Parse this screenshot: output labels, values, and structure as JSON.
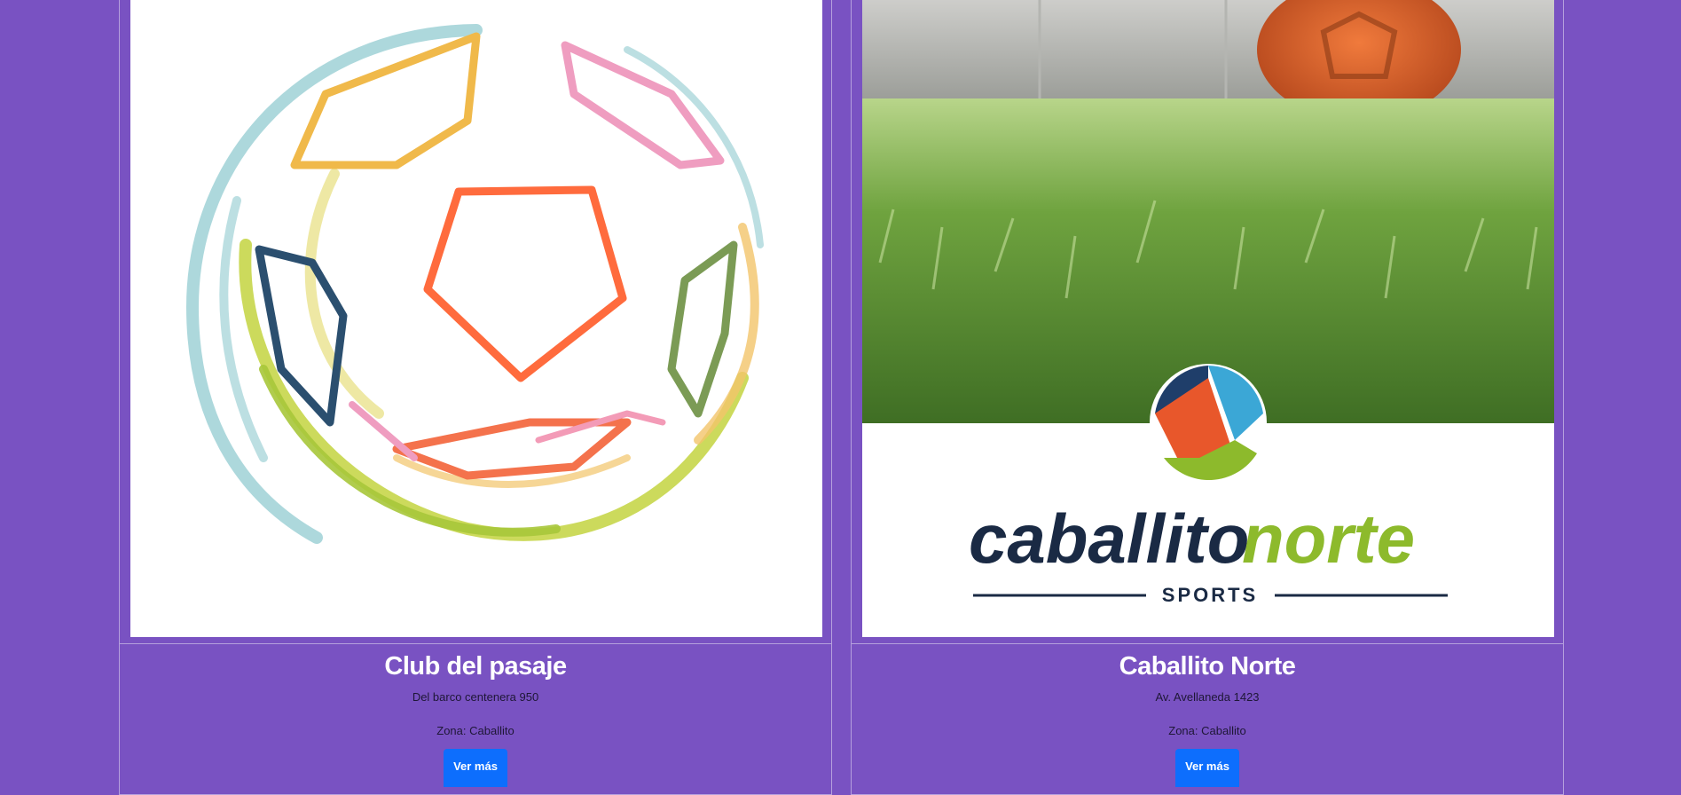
{
  "clubs": [
    {
      "name": "Club del pasaje",
      "address": "Del barco centenera 950",
      "zone": "Zona: Caballito",
      "button_label": "Ver más",
      "image": "soccer-ball-logo"
    },
    {
      "name": "Caballito Norte",
      "address": "Av. Avellaneda 1423",
      "zone": "Zona: Caballito",
      "button_label": "Ver más",
      "image": "caballito-norte-sports-logo",
      "logo": {
        "word1": "caballito",
        "word2": "norte",
        "sub": "SPORTS"
      }
    }
  ],
  "colors": {
    "background": "#7952c2",
    "button": "#0d6efd",
    "title_text": "#ffffff",
    "logo_navy": "#1a2a44",
    "logo_green": "#8dba2c"
  }
}
